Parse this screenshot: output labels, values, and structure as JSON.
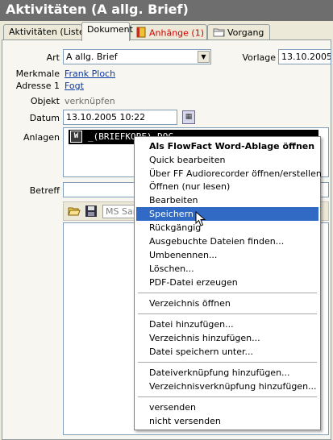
{
  "window": {
    "title": "Aktivitäten (A allg. Brief)"
  },
  "tabs": [
    {
      "label": "Aktivitäten (Liste)",
      "active": false
    },
    {
      "label": "Dokument",
      "active": true
    },
    {
      "label": "Anhänge (1)",
      "active": false,
      "icon": "book-icon",
      "color": "#cc0000"
    },
    {
      "label": "Vorgang",
      "active": false,
      "icon": "folder-icon"
    }
  ],
  "form": {
    "art_label": "Art",
    "art_value": "A allg. Brief",
    "vorlage_label": "Vorlage",
    "vorlage_value": "13.10.2005",
    "merkmale_label": "Merkmale",
    "merkmale_value": "Frank Ploch",
    "adresse_label": "Adresse 1",
    "adresse_value": "Fogt",
    "objekt_label": "Objekt",
    "objekt_value": "verknüpfen",
    "datum_label": "Datum",
    "datum_value": "13.10.2005 10:22",
    "anlagen_label": "Anlagen",
    "anlagen_item": "_(BRIEFKOPF).DOC",
    "betreff_label": "Betreff",
    "betreff_value": ""
  },
  "toolbar": {
    "font_name": "MS San"
  },
  "context_menu": {
    "items": [
      {
        "label": "Als FlowFact Word-Ablage öffnen",
        "bold": true
      },
      {
        "label": "Quick bearbeiten"
      },
      {
        "label": "Über FF Audiorecorder öffnen/erstellen"
      },
      {
        "label": "Öffnen (nur lesen)"
      },
      {
        "label": "Bearbeiten"
      },
      {
        "label": "Speichern",
        "highlighted": true
      },
      {
        "label": "Rückgängig"
      },
      {
        "label": "Ausgebuchte Dateien finden..."
      },
      {
        "label": "Umbenennen..."
      },
      {
        "label": "Löschen..."
      },
      {
        "label": "PDF-Datei erzeugen"
      },
      {
        "label": "Verzeichnis öffnen"
      },
      {
        "label": "Datei hinzufügen..."
      },
      {
        "label": "Verzeichnis hinzufügen..."
      },
      {
        "label": "Datei speichern unter..."
      },
      {
        "label": "Dateiverknüpfung hinzufügen..."
      },
      {
        "label": "Verzeichnisverknüpfung hinzufügen..."
      },
      {
        "label": "versenden"
      },
      {
        "label": "nicht versenden"
      }
    ]
  },
  "colors": {
    "title_bg": "#6e6e6e",
    "menu_highlight": "#316ac5",
    "link": "#0b3aa5",
    "anhaenge_red": "#cc0000"
  }
}
